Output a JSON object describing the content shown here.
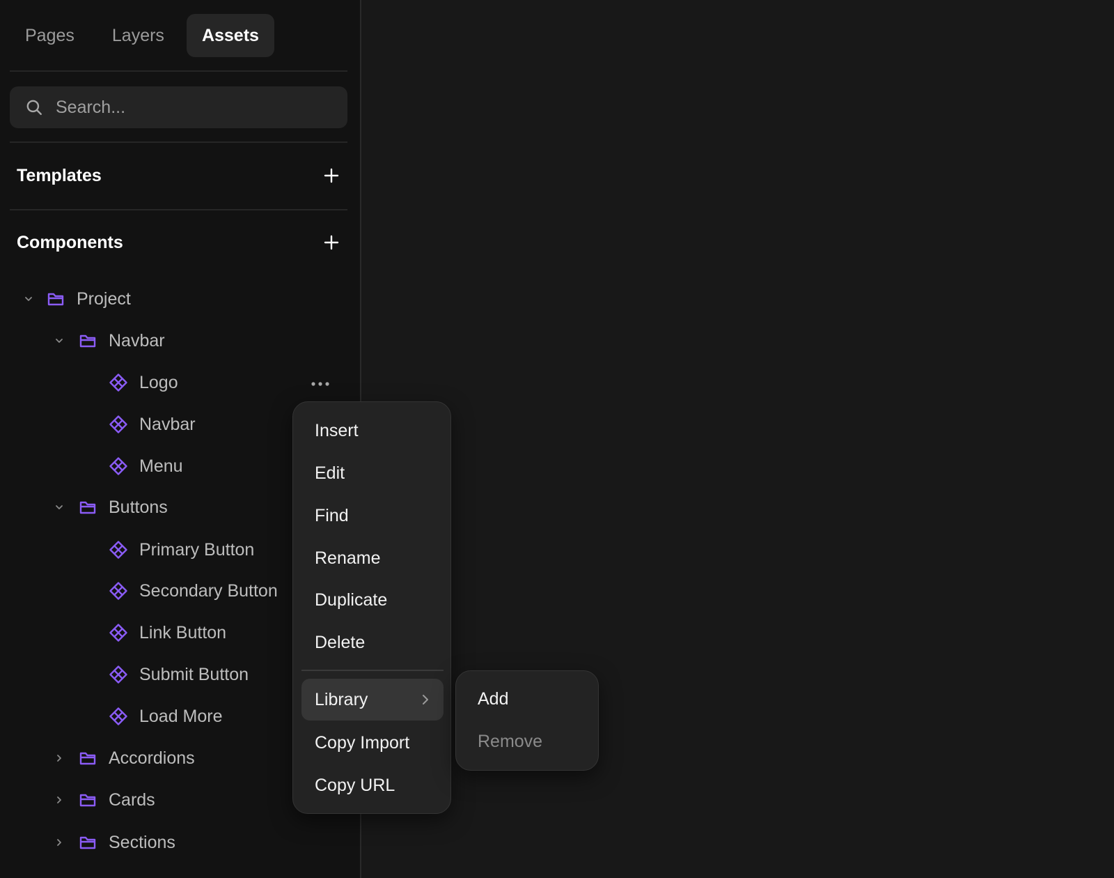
{
  "tabs": [
    {
      "label": "Pages",
      "active": false
    },
    {
      "label": "Layers",
      "active": false
    },
    {
      "label": "Assets",
      "active": true
    }
  ],
  "search": {
    "placeholder": "Search..."
  },
  "templates": {
    "title": "Templates"
  },
  "components": {
    "title": "Components"
  },
  "tree": {
    "project": "Project",
    "navbar_folder": "Navbar",
    "logo": "Logo",
    "navbar_comp": "Navbar",
    "menu": "Menu",
    "buttons_folder": "Buttons",
    "primary_button": "Primary Button",
    "secondary_button": "Secondary Button",
    "link_button": "Link Button",
    "submit_button": "Submit Button",
    "load_more": "Load More",
    "accordions": "Accordions",
    "cards": "Cards",
    "sections": "Sections"
  },
  "context_menu": {
    "insert": "Insert",
    "edit": "Edit",
    "find": "Find",
    "rename": "Rename",
    "duplicate": "Duplicate",
    "delete": "Delete",
    "library": "Library",
    "copy_import": "Copy Import",
    "copy_url": "Copy URL"
  },
  "submenu": {
    "add": "Add",
    "remove": "Remove"
  },
  "colors": {
    "background": "#181818",
    "sidebar": "#121212",
    "accent": "#8b5cf6",
    "menu_bg": "#232323"
  }
}
